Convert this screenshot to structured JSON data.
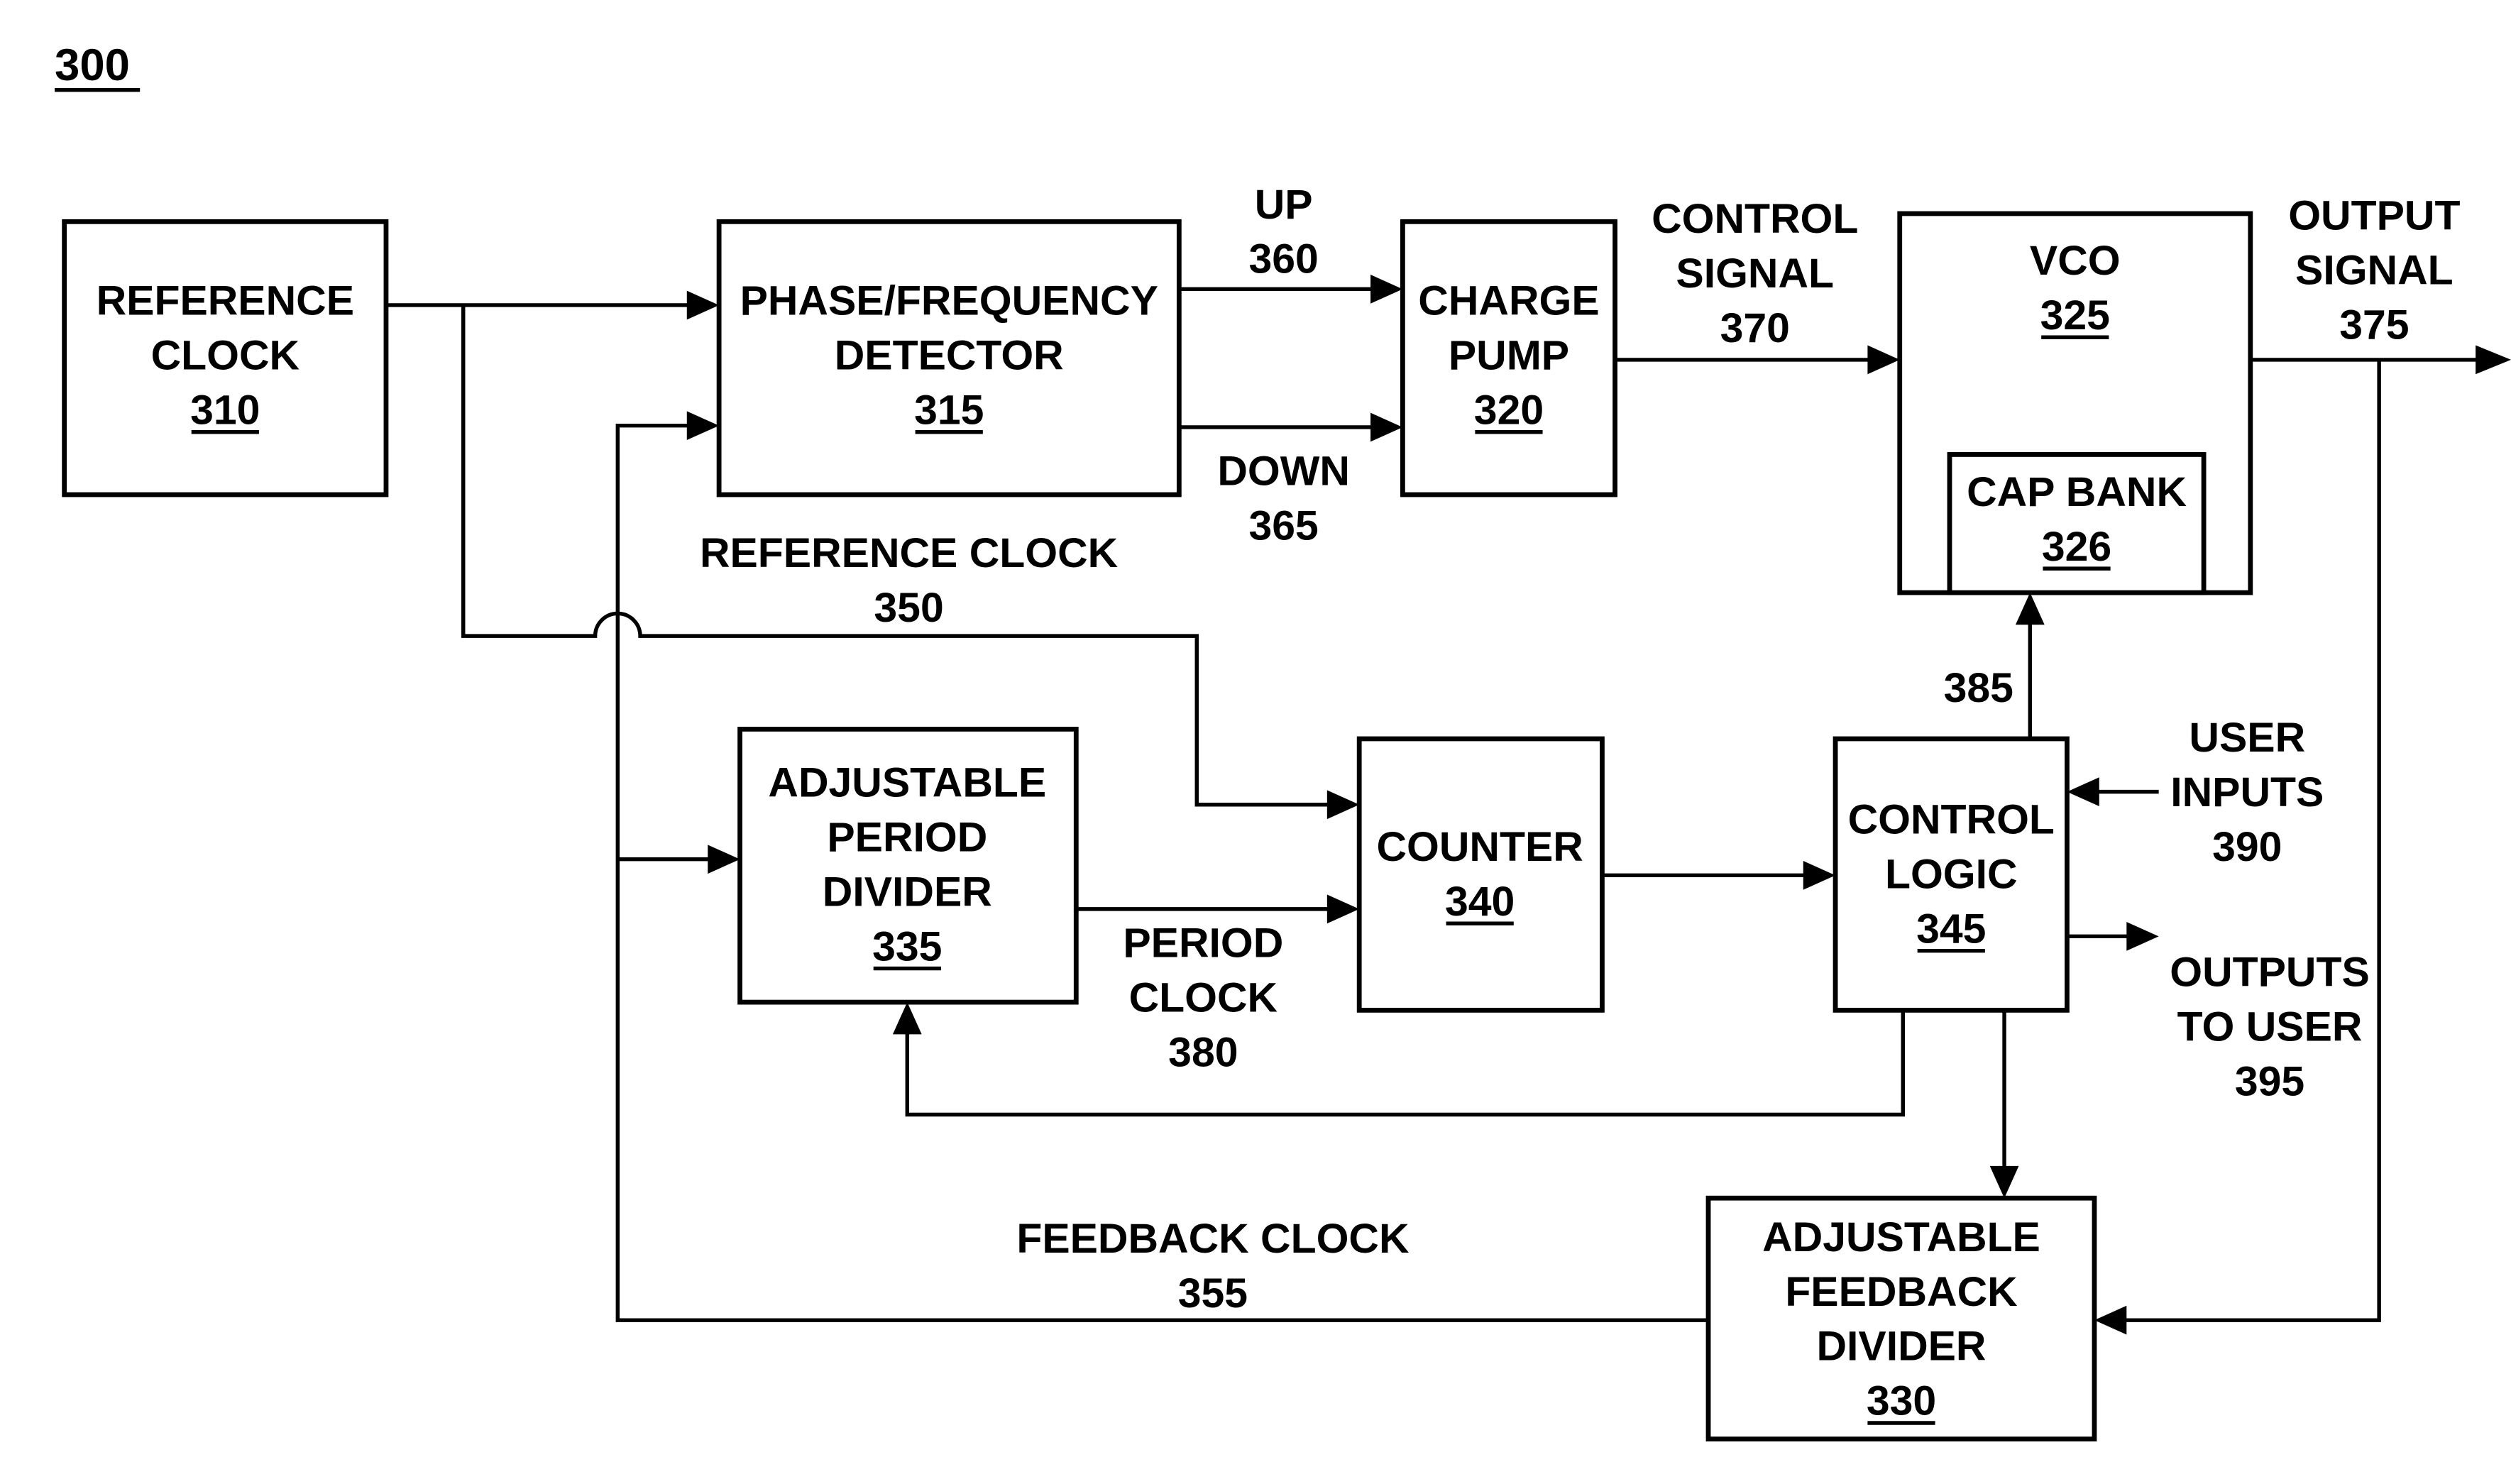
{
  "figure": {
    "number": "300"
  },
  "blocks": {
    "reference_clock": {
      "lines": [
        "REFERENCE",
        "CLOCK"
      ],
      "ref": "310"
    },
    "pfd": {
      "lines": [
        "PHASE/FREQUENCY",
        "DETECTOR"
      ],
      "ref": "315"
    },
    "charge_pump": {
      "lines": [
        "CHARGE",
        "PUMP"
      ],
      "ref": "320"
    },
    "vco": {
      "lines": [
        "VCO"
      ],
      "ref": "325"
    },
    "cap_bank": {
      "lines": [
        "CAP BANK"
      ],
      "ref": "326"
    },
    "feedback_divider": {
      "lines": [
        "ADJUSTABLE",
        "FEEDBACK",
        "DIVIDER"
      ],
      "ref": "330"
    },
    "period_divider": {
      "lines": [
        "ADJUSTABLE",
        "PERIOD",
        "DIVIDER"
      ],
      "ref": "335"
    },
    "counter": {
      "lines": [
        "COUNTER"
      ],
      "ref": "340"
    },
    "control_logic": {
      "lines": [
        "CONTROL",
        "LOGIC"
      ],
      "ref": "345"
    }
  },
  "signals": {
    "up": {
      "lines": [
        "UP",
        "360"
      ]
    },
    "down": {
      "lines": [
        "DOWN",
        "365"
      ]
    },
    "control_signal": {
      "lines": [
        "CONTROL",
        "SIGNAL",
        "370"
      ]
    },
    "output_signal": {
      "lines": [
        "OUTPUT",
        "SIGNAL",
        "375"
      ]
    },
    "reference_clock": {
      "lines": [
        "REFERENCE CLOCK",
        "350"
      ]
    },
    "feedback_clock": {
      "lines": [
        "FEEDBACK CLOCK",
        "355"
      ]
    },
    "period_clock": {
      "lines": [
        "PERIOD",
        "CLOCK",
        "380"
      ]
    },
    "cap_control": {
      "lines": [
        "385"
      ]
    },
    "user_inputs": {
      "lines": [
        "USER",
        "INPUTS",
        "390"
      ]
    },
    "outputs_to_user": {
      "lines": [
        "OUTPUTS",
        "TO USER",
        "395"
      ]
    }
  }
}
